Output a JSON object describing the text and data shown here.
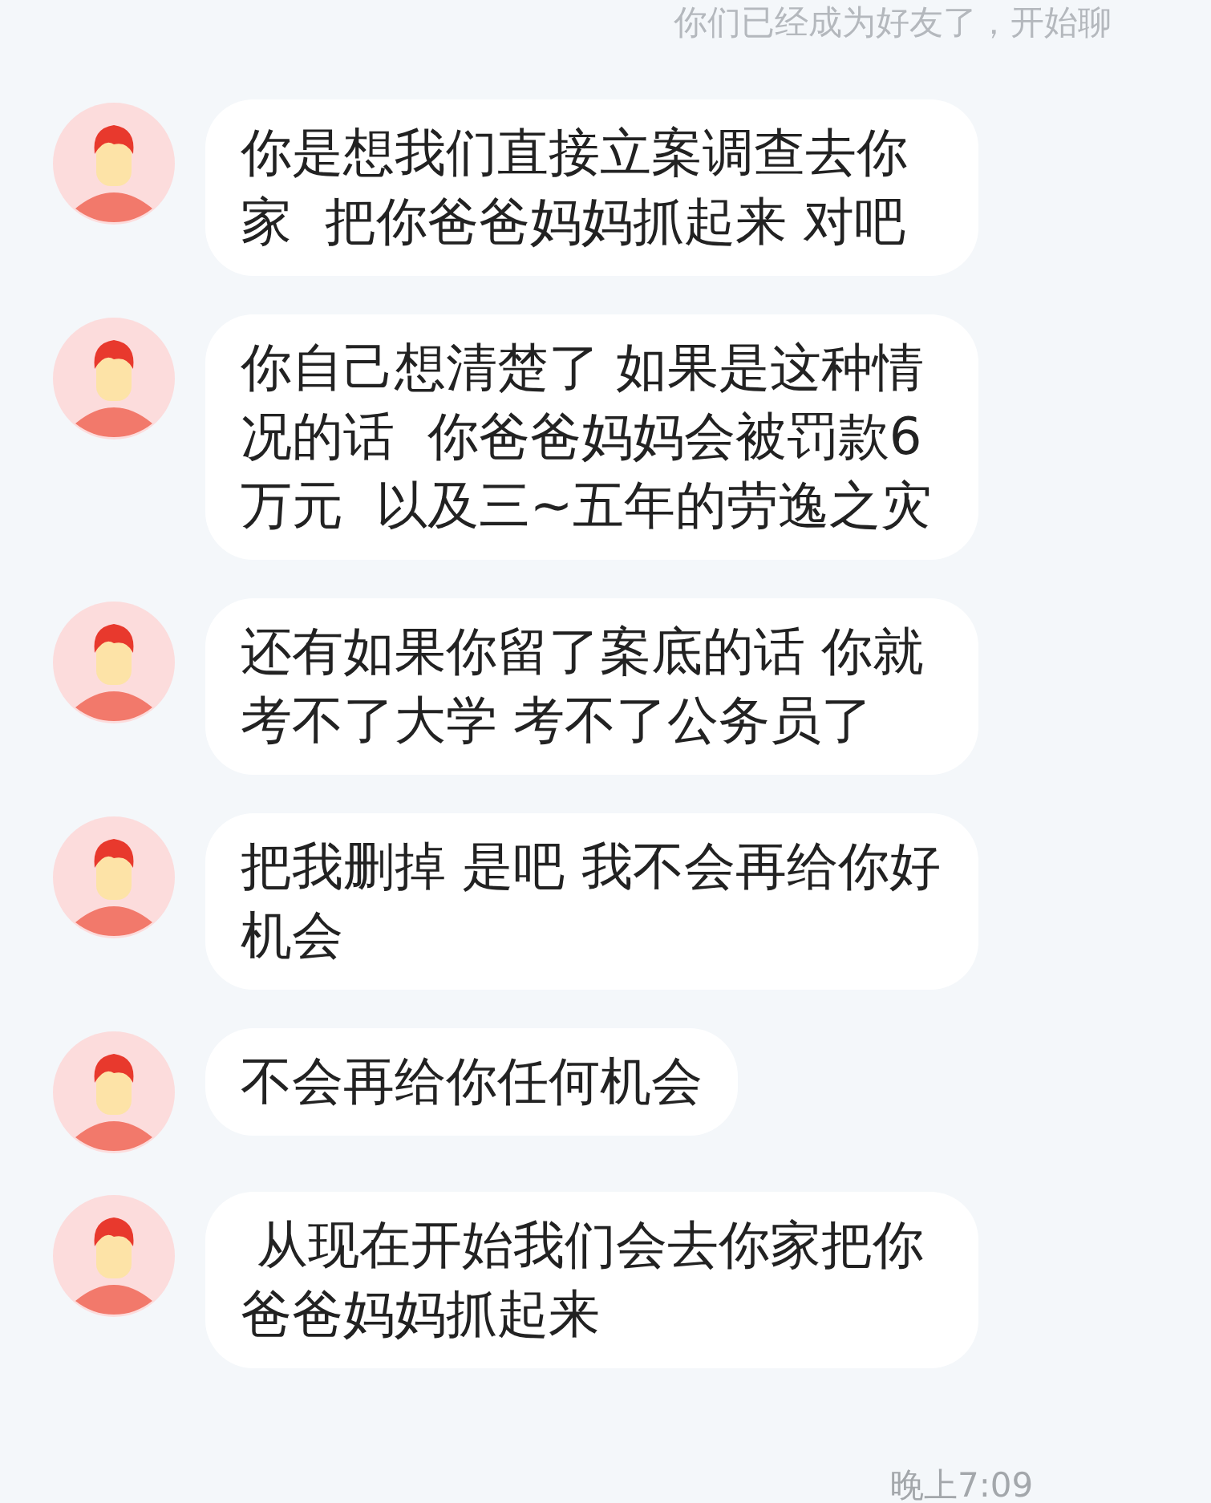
{
  "system_notice": "你们已经成为好友了，开始聊",
  "messages": [
    {
      "text": "你是想我们直接立案调查去你家  把你爸爸妈妈抓起来 对吧"
    },
    {
      "text": "你自己想清楚了 如果是这种情况的话  你爸爸妈妈会被罚款6万元  以及三~五年的劳逸之灾"
    },
    {
      "text": "还有如果你留了案底的话 你就考不了大学 考不了公务员了"
    },
    {
      "text": "把我删掉 是吧 我不会再给你好机会"
    },
    {
      "text": "不会再给你任何机会"
    },
    {
      "text": " 从现在开始我们会去你家把你爸爸妈妈抓起来"
    }
  ],
  "timestamp": "晚上7:09"
}
